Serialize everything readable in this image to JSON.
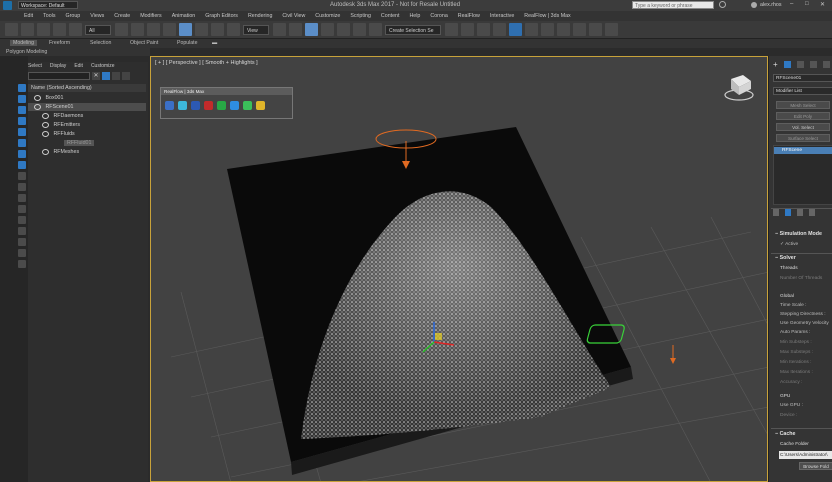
{
  "app": {
    "title": "Autodesk 3ds Max 2017 - Not for Resale   Untitled",
    "workspace": "Workspace: Default",
    "search_placeholder": "Type a keyword or phrase",
    "user": "alex.rhos"
  },
  "menu": [
    "Edit",
    "Tools",
    "Group",
    "Views",
    "Create",
    "Modifiers",
    "Animation",
    "Graph Editors",
    "Rendering",
    "Civil View",
    "Customize",
    "Scripting",
    "Content",
    "Help",
    "Corona",
    "RealFlow",
    "Interactive",
    "RealFlow | 3ds Max"
  ],
  "toolbar": {
    "selection_filter": "All",
    "view_dropdown": "View",
    "named_selection": "Create Selection Se"
  },
  "ribbon": {
    "tabs": [
      "Modeling",
      "Freeform",
      "Selection",
      "Object Paint",
      "Populate"
    ],
    "sub": "Polygon Modeling"
  },
  "explorer": {
    "tabs": [
      "Select",
      "Display",
      "Edit",
      "Customize"
    ],
    "header": "Name (Sorted Ascending)",
    "rows": [
      "Box001",
      "RFScene01",
      "RFDaemons",
      "RFEmitters",
      "RFFluids",
      "RFFluid01",
      "RFMeshes"
    ]
  },
  "viewport": {
    "label": "[ + ] [ Perspective ] [ Smooth + Highlights ]"
  },
  "floating_toolbar": {
    "title": "RealFlow | 3ds Max"
  },
  "command_panel": {
    "object_name": "RFScene01",
    "modifier_list": "Modifier List",
    "modifier_buttons": [
      "Mesh Select",
      "Edit Poly",
      "Vol. Select",
      "Surface Select"
    ],
    "stack_item": "RFScene",
    "sections": {
      "simulation_mode": "Simulation Mode",
      "active": "Active",
      "solver": "Solver",
      "threads": "Threads",
      "number_of_threads": "Number Of Threads",
      "global": "Global",
      "time_scale": "Time Scale :",
      "stepping_directness": "Stepping Directness :",
      "use_geometry_velocity": "Use Geometry Velocity",
      "auto_params": "Auto Params :",
      "min_substeps": "Min Substeps :",
      "max_substeps": "Max Substeps :",
      "min_iterations": "Min Iterations :",
      "max_iterations": "Max Iterations :",
      "accuracy": "Accuracy :",
      "gpu": "GPU",
      "use_gpu": "Use GPU :",
      "device": "Device :",
      "cache": "Cache",
      "cache_folder": "Cache Folder",
      "cache_path": "C:\\Users\\Administrator\\",
      "browse": "Browse Fold"
    }
  }
}
